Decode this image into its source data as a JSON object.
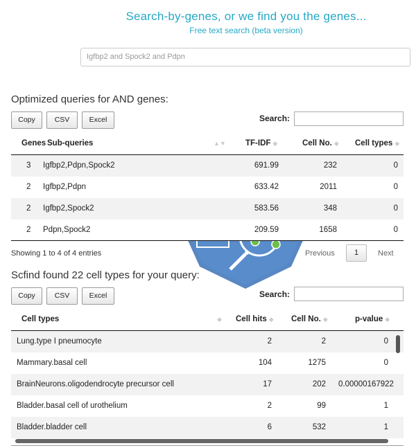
{
  "hero": {
    "title": "Search-by-genes, or we find you the genes...",
    "subtitle": "Free text search (beta version)"
  },
  "main_search": {
    "value": "Igfbp2 and Spock2 and Pdpn"
  },
  "queries": {
    "title": "Optimized queries for AND genes:",
    "buttons": {
      "copy": "Copy",
      "csv": "CSV",
      "excel": "Excel"
    },
    "search_label": "Search:",
    "columns": [
      "Genes",
      "Sub-queries",
      "TF-IDF",
      "Cell No.",
      "Cell types"
    ],
    "rows": [
      {
        "genes": "3",
        "sub": "Igfbp2,Pdpn,Spock2",
        "tfidf": "691.99",
        "cellno": "232",
        "celltypes": "0"
      },
      {
        "genes": "2",
        "sub": "Igfbp2,Pdpn",
        "tfidf": "633.42",
        "cellno": "2011",
        "celltypes": "0"
      },
      {
        "genes": "2",
        "sub": "Igfbp2,Spock2",
        "tfidf": "583.56",
        "cellno": "348",
        "celltypes": "0"
      },
      {
        "genes": "2",
        "sub": "Pdpn,Spock2",
        "tfidf": "209.59",
        "cellno": "1658",
        "celltypes": "0"
      }
    ],
    "info": "Showing 1 to 4 of 4 entries",
    "pager": {
      "previous": "Previous",
      "page": "1",
      "next": "Next"
    }
  },
  "celltypes": {
    "title": "Scfind found 22 cell types for your query:",
    "buttons": {
      "copy": "Copy",
      "csv": "CSV",
      "excel": "Excel"
    },
    "search_label": "Search:",
    "columns": [
      "Cell types",
      "Cell hits",
      "Cell No.",
      "p-value"
    ],
    "rows": [
      {
        "type": "Lung.type I pneumocyte",
        "hits": "2",
        "cellno": "2",
        "pvalue": "0"
      },
      {
        "type": "Mammary.basal cell",
        "hits": "104",
        "cellno": "1275",
        "pvalue": "0"
      },
      {
        "type": "BrainNeurons.oligodendrocyte precursor cell",
        "hits": "17",
        "cellno": "202",
        "pvalue": "0.00000167922"
      },
      {
        "type": "Bladder.basal cell of urothelium",
        "hits": "2",
        "cellno": "99",
        "pvalue": "1"
      },
      {
        "type": "Bladder.bladder cell",
        "hits": "6",
        "cellno": "532",
        "pvalue": "1"
      }
    ]
  },
  "colors": {
    "accent": "#26a9c5",
    "logo_blue": "#3b73b9"
  },
  "icons": [
    "sort-icon",
    "scfind-logo-watermark"
  ]
}
